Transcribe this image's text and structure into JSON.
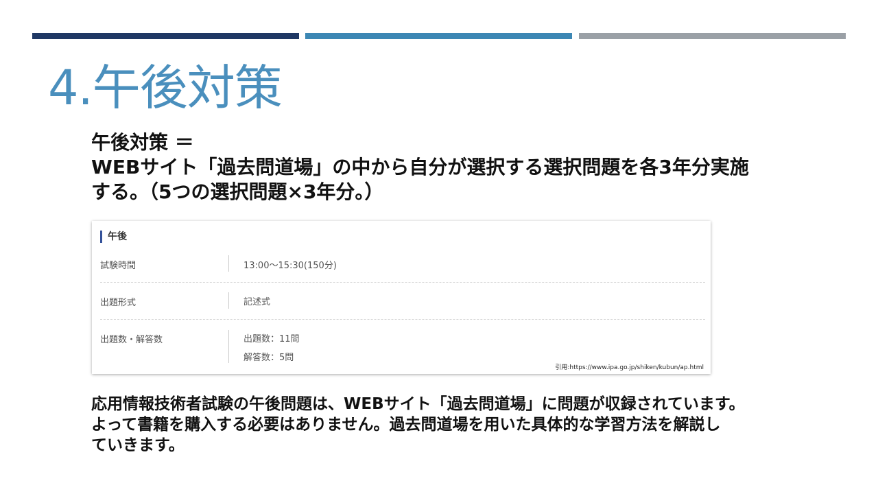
{
  "slide": {
    "title": "4.午後対策",
    "heading_lines": [
      "午後対策 ＝",
      "WEBサイト「過去問道場」の中から自分が選択する選択問題を各3年分実施",
      "する。（5つの選択問題×3年分。）"
    ],
    "accent_colors": [
      "#1f3864",
      "#3c87b4",
      "#9aa0a6"
    ],
    "title_color": "#4a8fbd"
  },
  "exam_card": {
    "header": "午後",
    "rows": [
      {
        "label": "試験時間",
        "values": [
          "13:00〜15:30(150分)"
        ]
      },
      {
        "label": "出題形式",
        "values": [
          "記述式"
        ]
      },
      {
        "label": "出題数・解答数",
        "values": [
          "出題数：11問",
          "解答数：5問"
        ]
      }
    ],
    "citation": "引用:https://www.ipa.go.jp/shiken/kubun/ap.html"
  },
  "paragraph_lines": [
    "応用情報技術者試験の午後問題は、WEBサイト「過去問道場」に問題が収録されています。",
    "よって書籍を購入する必要はありません。過去問道場を用いた具体的な学習方法を解説し",
    "ていきます。"
  ]
}
